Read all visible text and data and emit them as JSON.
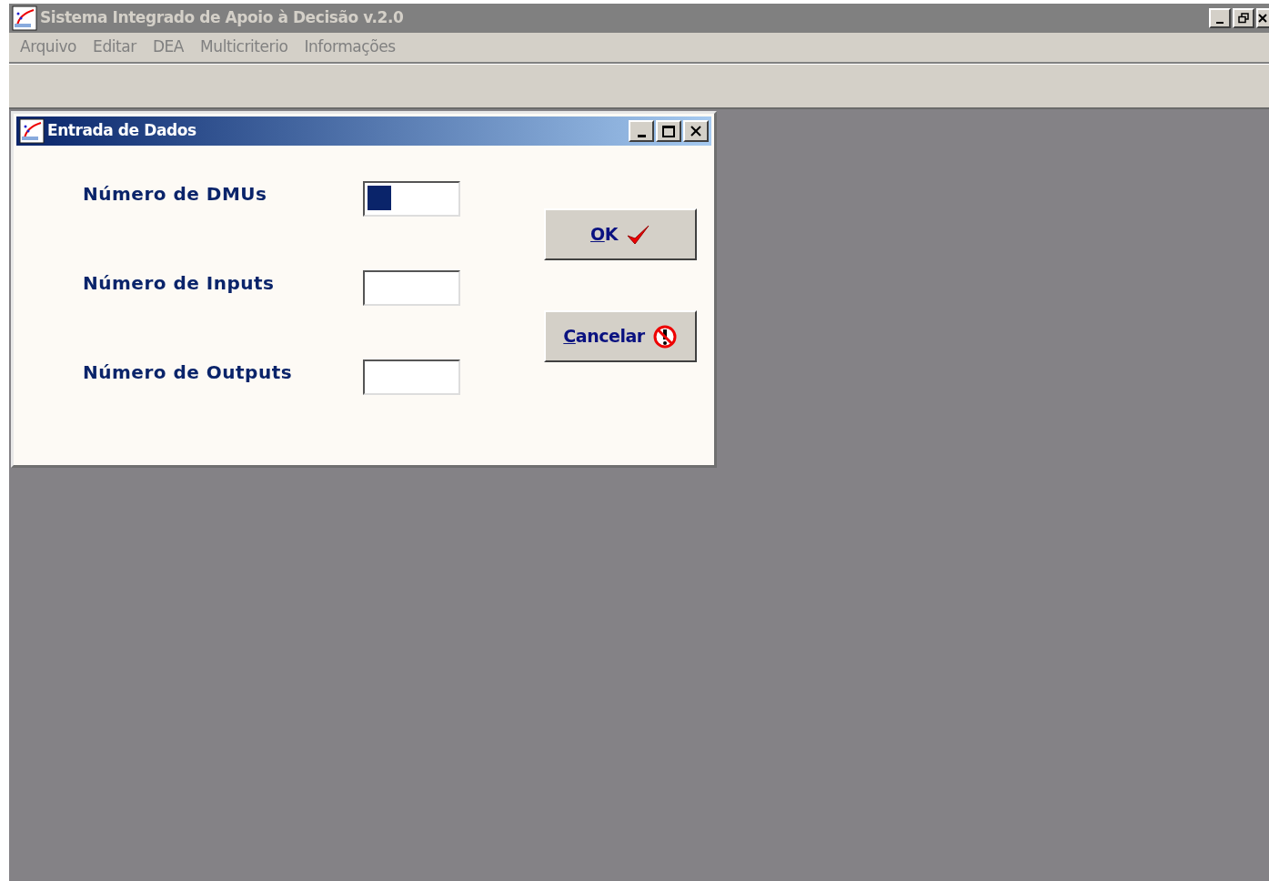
{
  "window": {
    "title": "Sistema Integrado de Apoio à Decisão v.2.0",
    "active": false
  },
  "menu": [
    "Arquivo",
    "Editar",
    "DEA",
    "Multicriterio",
    "Informações"
  ],
  "dialog": {
    "title": "Entrada de Dados",
    "active": true,
    "fields": [
      {
        "label": "Número de DMUs",
        "focused": true
      },
      {
        "label": "Número de Inputs",
        "focused": false
      },
      {
        "label": "Número de Outputs",
        "focused": false
      }
    ],
    "buttons": [
      {
        "label": "OK",
        "kind": "ok"
      },
      {
        "label": "Cancelar",
        "kind": "cancel"
      }
    ]
  }
}
